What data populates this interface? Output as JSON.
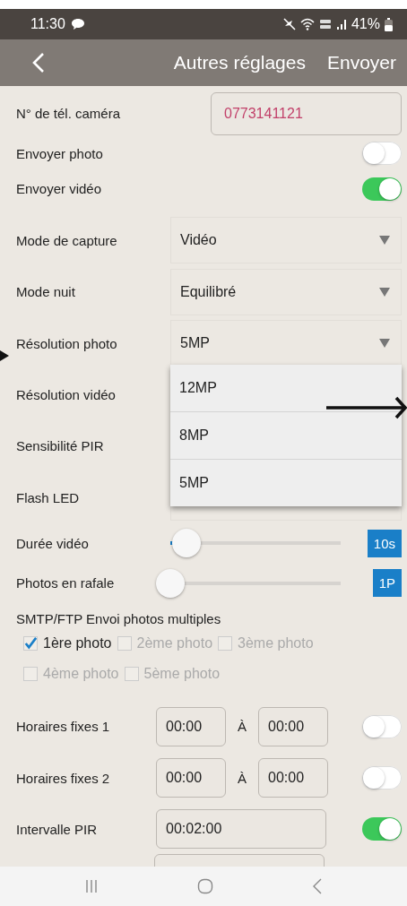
{
  "status_bar": {
    "time": "11:30",
    "battery": "41%"
  },
  "header": {
    "title": "Autres réglages",
    "action": "Envoyer"
  },
  "rows": [
    {
      "kind": "field",
      "label": "N° de tél. caméra",
      "value": "0773141121"
    },
    {
      "kind": "toggle",
      "label": "Envoyer photo",
      "on": false
    },
    {
      "kind": "toggle",
      "label": "Envoyer vidéo",
      "on": true
    },
    {
      "kind": "select",
      "label": "Mode de capture",
      "value": "Vidéo"
    },
    {
      "kind": "select",
      "label": "Mode nuit",
      "value": "Equilibré"
    },
    {
      "kind": "select",
      "label": "Résolution photo",
      "value": "5MP",
      "expanded": true,
      "options": [
        {
          "label": "12MP"
        },
        {
          "label": "8MP"
        },
        {
          "label": "5MP"
        }
      ]
    },
    {
      "kind": "label",
      "label": "Résolution vidéo"
    },
    {
      "kind": "label",
      "label": "Sensibilité PIR"
    },
    {
      "kind": "select",
      "label": "Flash LED"
    },
    {
      "kind": "slider",
      "label": "Durée vidéo",
      "level": 0.08,
      "reading": "10s"
    },
    {
      "kind": "slider",
      "label": "Photos en rafale",
      "level": 0,
      "reading": "1P"
    },
    {
      "kind": "checkgroup",
      "label": "SMTP/FTP Envoi photos multiples",
      "options": [
        {
          "label": "1ère photo",
          "checked": true
        },
        {
          "label": "2ème photo",
          "checked": false
        },
        {
          "label": "3ème photo",
          "checked": false
        },
        {
          "label": "4ème photo",
          "checked": false
        },
        {
          "label": "5ème photo",
          "checked": false
        }
      ]
    },
    {
      "kind": "schedule",
      "label": "Horaires fixes 1",
      "from": "00:00",
      "sep": "À",
      "to": "00:00",
      "on": false
    },
    {
      "kind": "schedule",
      "label": "Horaires fixes 2",
      "from": "00:00",
      "sep": "À",
      "to": "00:00",
      "on": false
    },
    {
      "kind": "interval",
      "label": "Intervalle PIR",
      "value": "00:02:00",
      "on": true
    },
    {
      "kind": "cut_field"
    }
  ]
}
